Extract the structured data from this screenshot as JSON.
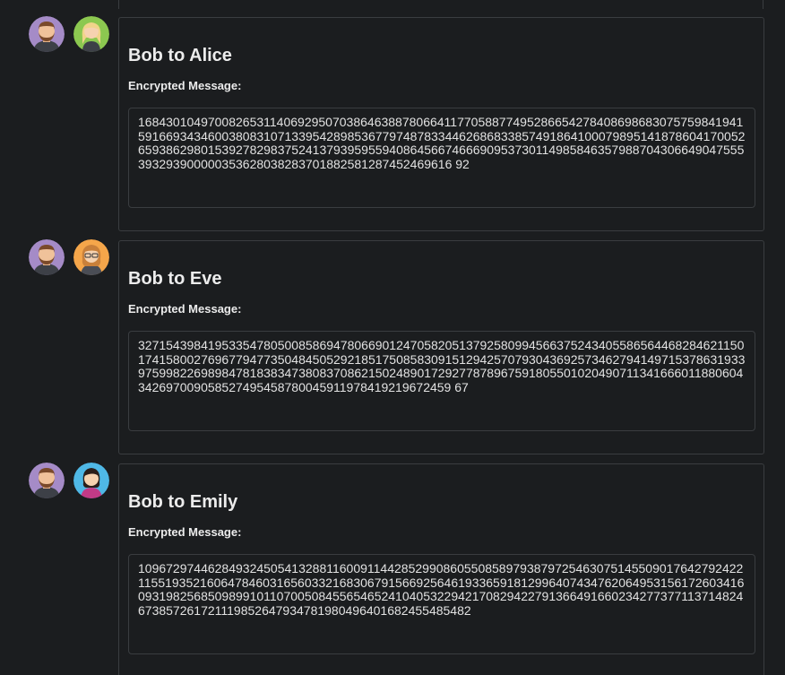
{
  "threads": [
    {
      "sender": "Bob",
      "recipient": "Alice",
      "title": "Bob to Alice",
      "label": "Encrypted Message:",
      "message": "168430104970082653114069295070386463887806641177058877495286654278408698683075759841941591669343460038083107133954289853677974878334462686833857491864100079895141878604170052659386298015392782983752413793959559408645667466690953730114985846357988704306649047555393293900000353628038283701882581287452469616 92",
      "sender_avatar": "bob-avatar-icon",
      "recipient_avatar": "alice-avatar-icon"
    },
    {
      "sender": "Bob",
      "recipient": "Eve",
      "title": "Bob to Eve",
      "label": "Encrypted Message:",
      "message": "327154398419533547805008586947806690124705820513792580994566375243405586564468284621150174158002769677947735048450529218517508583091512942570793043692573462794149715378631933975998226989847818383473808370862150248901729277878967591805501020490711341666011880604342697009058527495458780045911978419219672459 67",
      "sender_avatar": "bob-avatar-icon",
      "recipient_avatar": "eve-avatar-icon"
    },
    {
      "sender": "Bob",
      "recipient": "Emily",
      "title": "Bob to Emily",
      "label": "Encrypted Message:",
      "message": "109672974462849324505413288116009114428529908605508589793879725463075145509017642792422115519352160647846031656033216830679156692564619336591812996407434762064953156172603416093198256850989910110700508455654652410405322942170829422791366491660234277377113714824673857261721119852647934781980496401682455485482",
      "sender_avatar": "bob-avatar-icon",
      "recipient_avatar": "emily-avatar-icon"
    }
  ]
}
